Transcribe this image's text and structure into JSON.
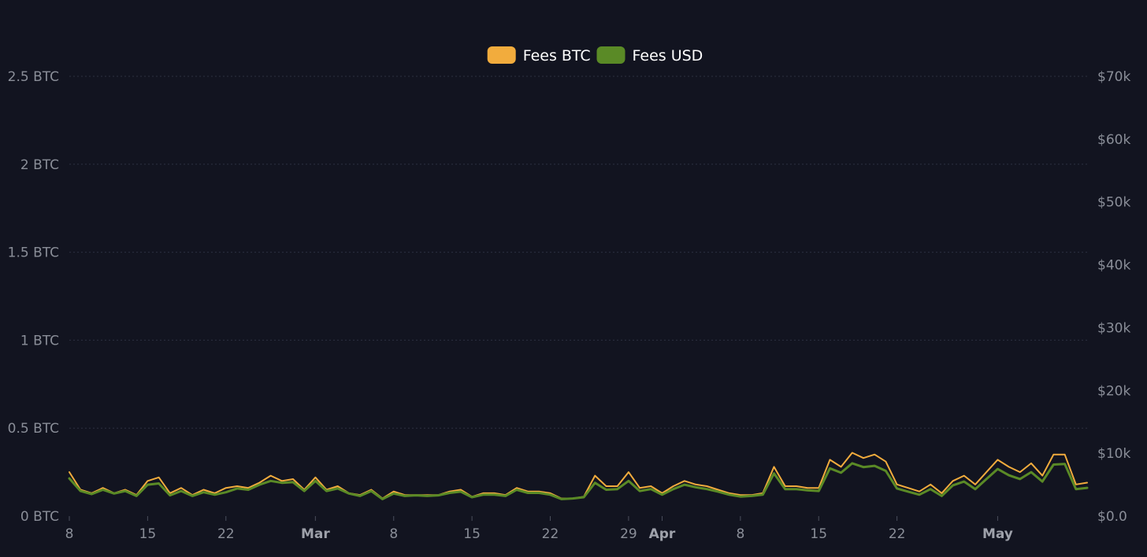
{
  "chart_data": {
    "type": "line",
    "legend": {
      "placement": "top-center",
      "items": [
        {
          "label": "Fees BTC",
          "color": "#f2ac3d"
        },
        {
          "label": "Fees USD",
          "color": "#5a8a26"
        }
      ]
    },
    "y_left": {
      "ylim": [
        0,
        2.5
      ],
      "ticks": [
        {
          "value": 0,
          "label": "0 BTC"
        },
        {
          "value": 0.5,
          "label": "0.5 BTC"
        },
        {
          "value": 1,
          "label": "1 BTC"
        },
        {
          "value": 1.5,
          "label": "1.5 BTC"
        },
        {
          "value": 2,
          "label": "2 BTC"
        },
        {
          "value": 2.5,
          "label": "2.5 BTC"
        }
      ]
    },
    "y_right": {
      "ylim": [
        0,
        70000
      ],
      "ticks": [
        {
          "value": 0,
          "label": "$0.0"
        },
        {
          "value": 10000,
          "label": "$10k"
        },
        {
          "value": 20000,
          "label": "$20k"
        },
        {
          "value": 30000,
          "label": "$30k"
        },
        {
          "value": 40000,
          "label": "$40k"
        },
        {
          "value": 50000,
          "label": "$50k"
        },
        {
          "value": 60000,
          "label": "$60k"
        },
        {
          "value": 70000,
          "label": "$70k"
        }
      ]
    },
    "x_axis": {
      "range": [
        "02-08",
        "05-09"
      ],
      "ticks": [
        {
          "date": "02-08",
          "label": "8",
          "month": false
        },
        {
          "date": "02-15",
          "label": "15",
          "month": false
        },
        {
          "date": "02-22",
          "label": "22",
          "month": false
        },
        {
          "date": "03-01",
          "label": "Mar",
          "month": true
        },
        {
          "date": "03-08",
          "label": "8",
          "month": false
        },
        {
          "date": "03-15",
          "label": "15",
          "month": false
        },
        {
          "date": "03-22",
          "label": "22",
          "month": false
        },
        {
          "date": "03-29",
          "label": "29",
          "month": false
        },
        {
          "date": "04-01",
          "label": "Apr",
          "month": true
        },
        {
          "date": "04-08",
          "label": "8",
          "month": false
        },
        {
          "date": "04-15",
          "label": "15",
          "month": false
        },
        {
          "date": "04-22",
          "label": "22",
          "month": false
        },
        {
          "date": "05-01",
          "label": "May",
          "month": true
        }
      ]
    },
    "grid": true,
    "series": [
      {
        "name": "Fees BTC",
        "axis": "left",
        "color": "#f2ac3d",
        "points": [
          [
            "02-08",
            0.25
          ],
          [
            "02-09",
            0.15
          ],
          [
            "02-10",
            0.13
          ],
          [
            "02-11",
            0.16
          ],
          [
            "02-12",
            0.13
          ],
          [
            "02-13",
            0.15
          ],
          [
            "02-14",
            0.12
          ],
          [
            "02-15",
            0.2
          ],
          [
            "02-16",
            0.22
          ],
          [
            "02-17",
            0.13
          ],
          [
            "02-18",
            0.16
          ],
          [
            "02-19",
            0.12
          ],
          [
            "02-20",
            0.15
          ],
          [
            "02-21",
            0.13
          ],
          [
            "02-22",
            0.16
          ],
          [
            "02-23",
            0.17
          ],
          [
            "02-24",
            0.16
          ],
          [
            "02-25",
            0.19
          ],
          [
            "02-26",
            0.23
          ],
          [
            "02-27",
            0.2
          ],
          [
            "02-28",
            0.21
          ],
          [
            "02-29",
            0.15
          ],
          [
            "03-01",
            0.22
          ],
          [
            "03-02",
            0.15
          ],
          [
            "03-03",
            0.17
          ],
          [
            "03-04",
            0.13
          ],
          [
            "03-05",
            0.12
          ],
          [
            "03-06",
            0.15
          ],
          [
            "03-07",
            0.1
          ],
          [
            "03-08",
            0.14
          ],
          [
            "03-09",
            0.12
          ],
          [
            "03-10",
            0.12
          ],
          [
            "03-11",
            0.12
          ],
          [
            "03-12",
            0.12
          ],
          [
            "03-13",
            0.14
          ],
          [
            "03-14",
            0.15
          ],
          [
            "03-15",
            0.11
          ],
          [
            "03-16",
            0.13
          ],
          [
            "03-17",
            0.13
          ],
          [
            "03-18",
            0.12
          ],
          [
            "03-19",
            0.16
          ],
          [
            "03-20",
            0.14
          ],
          [
            "03-21",
            0.14
          ],
          [
            "03-22",
            0.13
          ],
          [
            "03-23",
            0.1
          ],
          [
            "03-24",
            0.1
          ],
          [
            "03-25",
            0.11
          ],
          [
            "03-26",
            0.23
          ],
          [
            "03-27",
            0.17
          ],
          [
            "03-28",
            0.17
          ],
          [
            "03-29",
            0.25
          ],
          [
            "03-30",
            0.16
          ],
          [
            "03-31",
            0.17
          ],
          [
            "04-01",
            0.13
          ],
          [
            "04-02",
            0.17
          ],
          [
            "04-03",
            0.2
          ],
          [
            "04-04",
            0.18
          ],
          [
            "04-05",
            0.17
          ],
          [
            "04-06",
            0.15
          ],
          [
            "04-07",
            0.13
          ],
          [
            "04-08",
            0.12
          ],
          [
            "04-09",
            0.12
          ],
          [
            "04-10",
            0.13
          ],
          [
            "04-11",
            0.28
          ],
          [
            "04-12",
            0.17
          ],
          [
            "04-13",
            0.17
          ],
          [
            "04-14",
            0.16
          ],
          [
            "04-15",
            0.16
          ],
          [
            "04-16",
            0.32
          ],
          [
            "04-17",
            0.28
          ],
          [
            "04-18",
            0.36
          ],
          [
            "04-19",
            0.33
          ],
          [
            "04-20",
            0.35
          ],
          [
            "04-21",
            0.31
          ],
          [
            "04-22",
            0.18
          ],
          [
            "04-23",
            0.16
          ],
          [
            "04-24",
            0.14
          ],
          [
            "04-25",
            0.18
          ],
          [
            "04-26",
            0.13
          ],
          [
            "04-27",
            0.2
          ],
          [
            "04-28",
            0.23
          ],
          [
            "04-29",
            0.18
          ],
          [
            "04-30",
            0.25
          ],
          [
            "05-01",
            0.32
          ],
          [
            "05-02",
            0.28
          ],
          [
            "05-03",
            0.25
          ],
          [
            "05-04",
            0.3
          ],
          [
            "05-05",
            0.23
          ],
          [
            "05-06",
            0.35
          ],
          [
            "05-07",
            0.35
          ],
          [
            "05-08",
            0.18
          ],
          [
            "05-09",
            0.19
          ]
        ]
      },
      {
        "name": "Fees USD",
        "axis": "right",
        "color": "#5a8a26",
        "points": [
          [
            "02-08",
            6000
          ],
          [
            "02-09",
            4000
          ],
          [
            "02-10",
            3500
          ],
          [
            "02-11",
            4200
          ],
          [
            "02-12",
            3600
          ],
          [
            "02-13",
            4000
          ],
          [
            "02-14",
            3200
          ],
          [
            "02-15",
            5000
          ],
          [
            "02-16",
            5200
          ],
          [
            "02-17",
            3300
          ],
          [
            "02-18",
            4000
          ],
          [
            "02-19",
            3200
          ],
          [
            "02-20",
            3800
          ],
          [
            "02-21",
            3400
          ],
          [
            "02-22",
            3800
          ],
          [
            "02-23",
            4400
          ],
          [
            "02-24",
            4200
          ],
          [
            "02-25",
            5000
          ],
          [
            "02-26",
            5600
          ],
          [
            "02-27",
            5300
          ],
          [
            "02-28",
            5400
          ],
          [
            "02-29",
            4000
          ],
          [
            "03-01",
            5600
          ],
          [
            "03-02",
            4000
          ],
          [
            "03-03",
            4400
          ],
          [
            "03-04",
            3600
          ],
          [
            "03-05",
            3200
          ],
          [
            "03-06",
            4000
          ],
          [
            "03-07",
            2700
          ],
          [
            "03-08",
            3600
          ],
          [
            "03-09",
            3200
          ],
          [
            "03-10",
            3300
          ],
          [
            "03-11",
            3200
          ],
          [
            "03-12",
            3300
          ],
          [
            "03-13",
            3700
          ],
          [
            "03-14",
            3900
          ],
          [
            "03-15",
            3000
          ],
          [
            "03-16",
            3400
          ],
          [
            "03-17",
            3400
          ],
          [
            "03-18",
            3200
          ],
          [
            "03-19",
            4200
          ],
          [
            "03-20",
            3700
          ],
          [
            "03-21",
            3700
          ],
          [
            "03-22",
            3400
          ],
          [
            "03-23",
            2700
          ],
          [
            "03-24",
            2800
          ],
          [
            "03-25",
            3000
          ],
          [
            "03-26",
            5300
          ],
          [
            "03-27",
            4200
          ],
          [
            "03-28",
            4300
          ],
          [
            "03-29",
            5600
          ],
          [
            "03-30",
            4000
          ],
          [
            "03-31",
            4300
          ],
          [
            "04-01",
            3400
          ],
          [
            "04-02",
            4300
          ],
          [
            "04-03",
            5000
          ],
          [
            "04-04",
            4600
          ],
          [
            "04-05",
            4300
          ],
          [
            "04-06",
            3900
          ],
          [
            "04-07",
            3400
          ],
          [
            "04-08",
            3100
          ],
          [
            "04-09",
            3200
          ],
          [
            "04-10",
            3400
          ],
          [
            "04-11",
            6800
          ],
          [
            "04-12",
            4300
          ],
          [
            "04-13",
            4300
          ],
          [
            "04-14",
            4100
          ],
          [
            "04-15",
            4000
          ],
          [
            "04-16",
            7600
          ],
          [
            "04-17",
            6900
          ],
          [
            "04-18",
            8400
          ],
          [
            "04-19",
            7800
          ],
          [
            "04-20",
            8000
          ],
          [
            "04-21",
            7200
          ],
          [
            "04-22",
            4400
          ],
          [
            "04-23",
            3900
          ],
          [
            "04-24",
            3400
          ],
          [
            "04-25",
            4300
          ],
          [
            "04-26",
            3200
          ],
          [
            "04-27",
            4900
          ],
          [
            "04-28",
            5500
          ],
          [
            "04-29",
            4300
          ],
          [
            "04-30",
            5900
          ],
          [
            "05-01",
            7500
          ],
          [
            "05-02",
            6500
          ],
          [
            "05-03",
            5900
          ],
          [
            "05-04",
            7000
          ],
          [
            "05-05",
            5500
          ],
          [
            "05-06",
            8200
          ],
          [
            "05-07",
            8300
          ],
          [
            "05-08",
            4300
          ],
          [
            "05-09",
            4500
          ]
        ]
      }
    ]
  }
}
